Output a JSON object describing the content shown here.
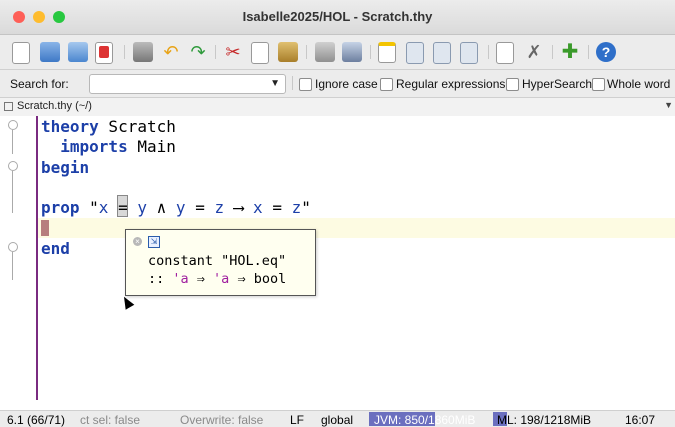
{
  "window": {
    "title": "Isabelle2025/HOL - Scratch.thy"
  },
  "toolbar": {
    "icons": [
      "new-file-icon",
      "open-folder-icon",
      "reload-icon",
      "close-file-icon",
      "print-icon",
      "undo-icon",
      "redo-icon",
      "cut-icon",
      "copy-icon",
      "paste-icon",
      "find-icon",
      "find-in-files-icon",
      "new-view-icon",
      "full-screen-icon",
      "split-vertical-icon",
      "split-horizontal-icon",
      "buffer-options-icon",
      "global-options-icon",
      "plugin-manager-icon",
      "help-icon"
    ]
  },
  "search": {
    "label": "Search for:",
    "value": "",
    "options": [
      "Ignore case",
      "Regular expressions",
      "HyperSearch",
      "Whole word"
    ]
  },
  "filetab": {
    "label": "Scratch.thy (~/)"
  },
  "code": {
    "line1_kw": "theory",
    "line1_rest": " Scratch",
    "line2_kw": "imports",
    "line2_rest": " Main",
    "line3_kw": "begin",
    "line5_kw": "prop",
    "line5_q1": " \"",
    "line5_x": "x",
    "line5_eq": "=",
    "line5_y1": "y",
    "line5_and": "∧",
    "line5_y2": "y",
    "line5_eq2": "=",
    "line5_z1": "z",
    "line5_imp": "⟶",
    "line5_x2": "x",
    "line5_eq3": "=",
    "line5_z2": "z",
    "line5_q2": "\"",
    "line7_kw": "end"
  },
  "tooltip": {
    "line1": "constant \"HOL.eq\"",
    "line2_prefix": ":: ",
    "tv1": "'a",
    "arrow1": " ⇒ ",
    "tv2": "'a",
    "arrow2": " ⇒ ",
    "ret": "bool"
  },
  "status": {
    "pos": "6.1 (66/71)",
    "rect_sel": "ct sel: false",
    "overwrite": "Overwrite: false",
    "line_ending": "LF",
    "mode": "global",
    "jvm": "JVM: 850/1860MiB",
    "ml": "ML: 198/1218MiB",
    "time": "16:07"
  },
  "colors": {
    "keyword": "#1c3fa8",
    "gutter_line": "#7a2b80",
    "type_var": "#a020a0"
  }
}
